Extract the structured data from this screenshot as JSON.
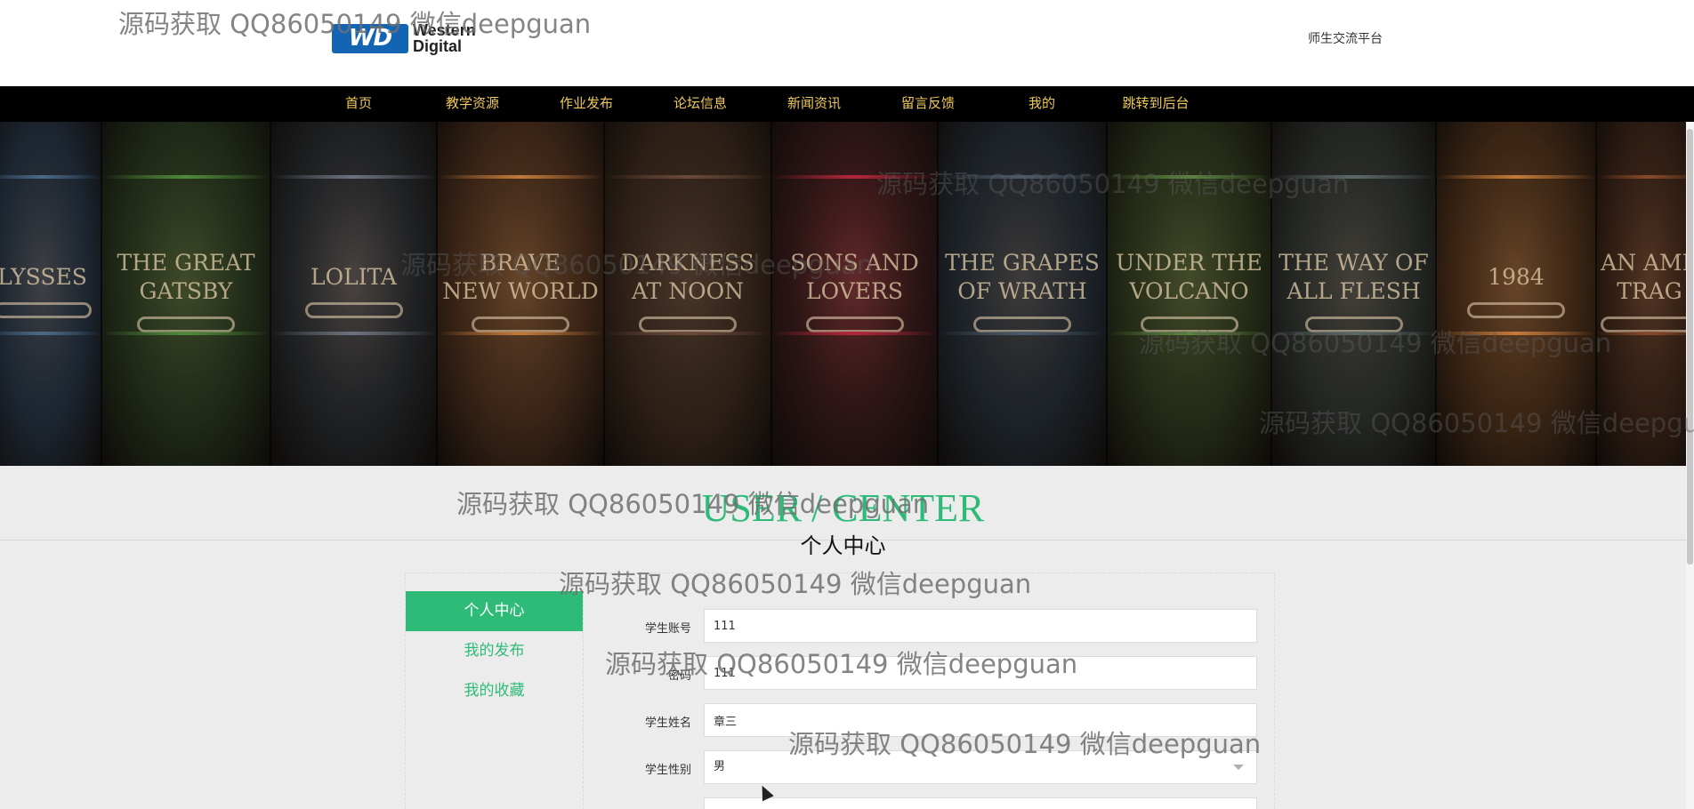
{
  "header": {
    "logo_badge": "WD",
    "logo_line1": "Western",
    "logo_line2": "Digital",
    "platform_name": "师生交流平台"
  },
  "nav": {
    "items": [
      "首页",
      "教学资源",
      "作业发布",
      "论坛信息",
      "新闻资讯",
      "留言反馈",
      "我的",
      "跳转到后台"
    ]
  },
  "banner": {
    "books": [
      {
        "title": "LYSSES",
        "band": "#4a6a8a"
      },
      {
        "title": "THE GREAT\nGATSBY",
        "band": "#4f8a3c"
      },
      {
        "title": "LOLITA",
        "band": "#6b7280"
      },
      {
        "title": "BRAVE\nNEW WORLD",
        "band": "#c27a3c"
      },
      {
        "title": "DARKNESS\nAT NOON",
        "band": "#6b4a3a"
      },
      {
        "title": "SONS AND\nLOVERS",
        "band": "#b3263a"
      },
      {
        "title": "THE GRAPES\nOF WRATH",
        "band": "#4a5a6a"
      },
      {
        "title": "UNDER THE\nVOLCANO",
        "band": "#5a8a3c"
      },
      {
        "title": "THE WAY OF\nALL FLESH",
        "band": "#5a6a6a"
      },
      {
        "title": "1984",
        "band": "#c47a3a"
      },
      {
        "title": "AN AME\nTRAG",
        "band": "#8a4a2a"
      }
    ]
  },
  "section": {
    "heading_en": "USER / CENTER",
    "heading_zh": "个人中心"
  },
  "side_menu": {
    "items": [
      "个人中心",
      "我的发布",
      "我的收藏"
    ]
  },
  "form": {
    "account_label": "学生账号",
    "account_value": "111",
    "password_label": "密码",
    "password_value": "111",
    "name_label": "学生姓名",
    "name_value": "章三",
    "gender_label": "学生性别",
    "gender_value": "男"
  },
  "watermark": {
    "text": "源码获取 QQ86050149 微信deepguan"
  }
}
